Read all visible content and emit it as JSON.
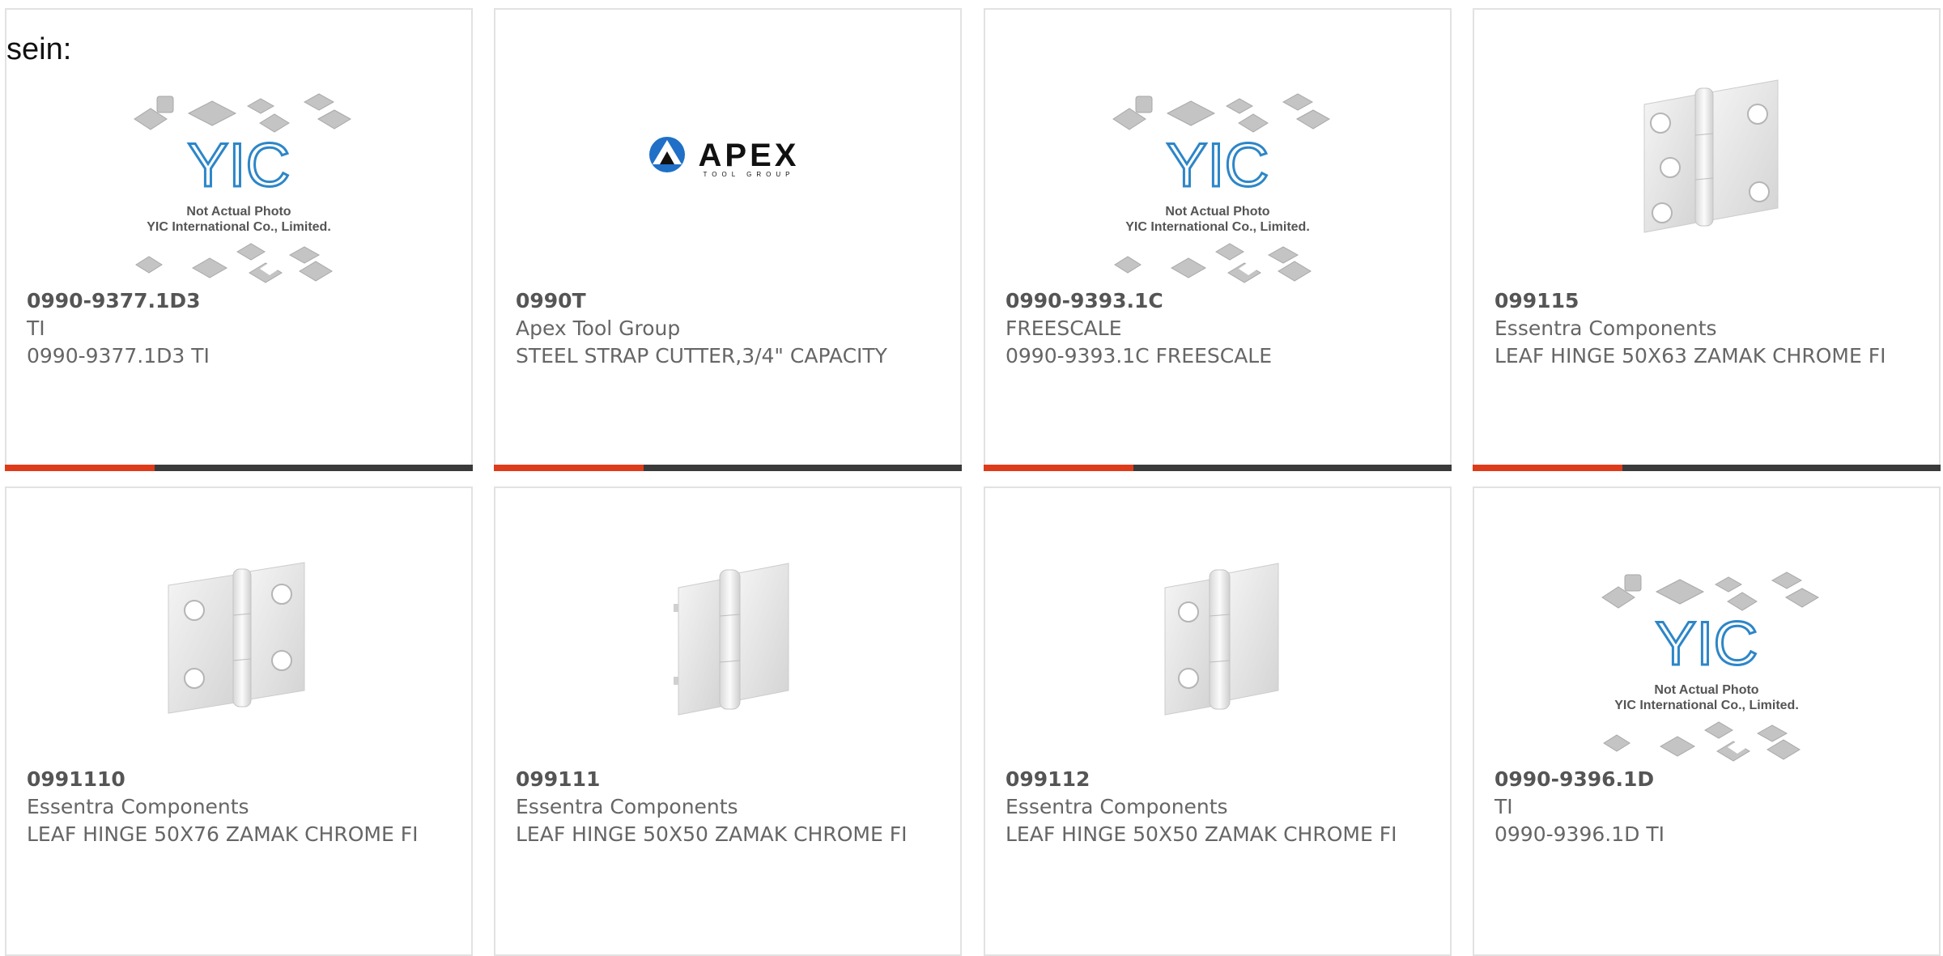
{
  "lead_text": "sein:",
  "colors": {
    "accent_orange": "#de3b1a",
    "accent_dark": "#3a3a3a",
    "text_gray": "#666666",
    "border": "#e2e2e2"
  },
  "products": [
    {
      "part_number": "0990-9377.1D3",
      "maker": "TI",
      "description": "0990-9377.1D3 TI",
      "image": "yic-placeholder",
      "image_text": [
        "Not Actual Photo",
        "YIC International Co., Limited."
      ]
    },
    {
      "part_number": "0990T",
      "maker": "Apex Tool Group",
      "description": "STEEL STRAP CUTTER,3/4\" CAPACITY",
      "image": "apex-logo",
      "image_text": [
        "APEX",
        "TOOL GROUP"
      ]
    },
    {
      "part_number": "0990-9393.1C",
      "maker": "FREESCALE",
      "description": "0990-9393.1C FREESCALE",
      "image": "yic-placeholder",
      "image_text": [
        "Not Actual Photo",
        "YIC International Co., Limited."
      ]
    },
    {
      "part_number": "099115",
      "maker": "Essentra Components",
      "description": "LEAF HINGE 50X63 ZAMAK CHROME FI",
      "image": "hinge-photo"
    },
    {
      "part_number": "0991110",
      "maker": "Essentra Components",
      "description": "LEAF HINGE 50X76 ZAMAK CHROME FI",
      "image": "hinge-photo"
    },
    {
      "part_number": "099111",
      "maker": "Essentra Components",
      "description": "LEAF HINGE 50X50 ZAMAK CHROME FI",
      "image": "hinge-photo"
    },
    {
      "part_number": "099112",
      "maker": "Essentra Components",
      "description": "LEAF HINGE 50X50 ZAMAK CHROME FI",
      "image": "hinge-photo"
    },
    {
      "part_number": "0990-9396.1D",
      "maker": "TI",
      "description": "0990-9396.1D TI",
      "image": "yic-placeholder",
      "image_text": [
        "Not Actual Photo",
        "YIC International Co., Limited."
      ]
    }
  ]
}
